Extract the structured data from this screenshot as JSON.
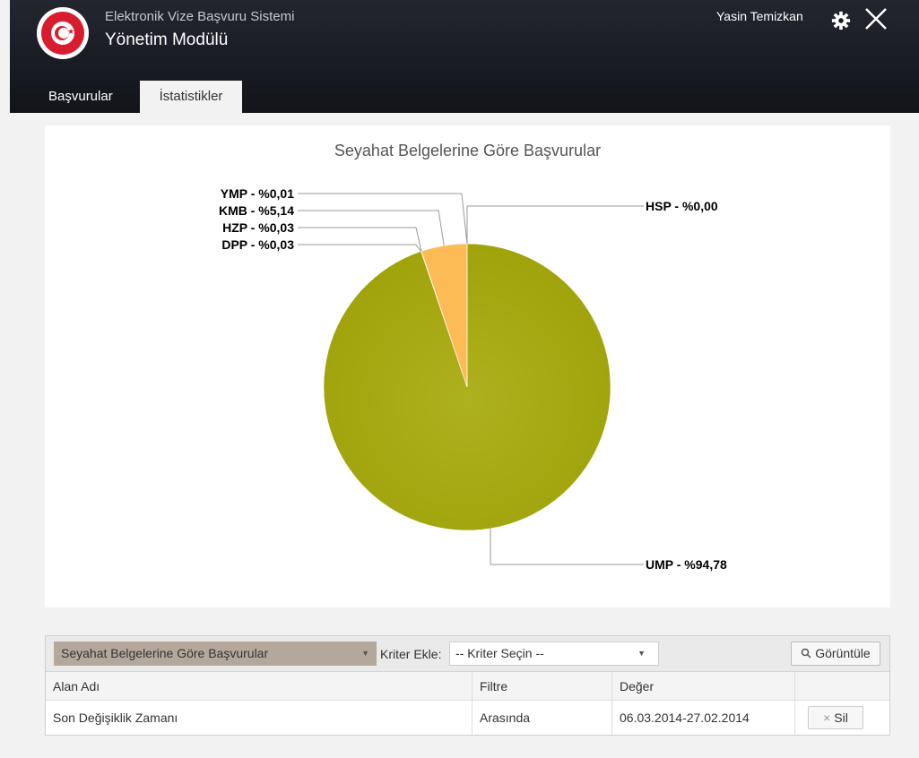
{
  "header": {
    "subtitle": "Elektronik Vize Başvuru Sistemi",
    "title": "Yönetim Modülü",
    "user": "Yasin Temizkan",
    "accent": "#d81e2e"
  },
  "tabs": [
    {
      "label": "Başvurular",
      "active": false
    },
    {
      "label": "İstatistikler",
      "active": true
    }
  ],
  "chart_data": {
    "type": "pie",
    "title": "Seyahat Belgelerine Göre Başvurular",
    "slices": [
      {
        "name": "HSP",
        "label": "HSP - %0,00",
        "value": 0.0,
        "color": "#d8dd55"
      },
      {
        "name": "UMP",
        "label": "UMP - %94,78",
        "value": 94.78,
        "color": "#a7aa12"
      },
      {
        "name": "DPP",
        "label": "DPP - %0,03",
        "value": 0.03,
        "color": "#8a8f10"
      },
      {
        "name": "HZP",
        "label": "HZP - %0,03",
        "value": 0.03,
        "color": "#c8b040"
      },
      {
        "name": "KMB",
        "label": "KMB - %5,14",
        "value": 5.14,
        "color": "#fdbb55"
      },
      {
        "name": "YMP",
        "label": "YMP - %0,01",
        "value": 0.01,
        "color": "#e0c060"
      }
    ]
  },
  "filter": {
    "report_select": "Seyahat Belgelerine Göre Başvurular",
    "criteria_label": "Kriter Ekle:",
    "criteria_select": "-- Kriter Seçin --",
    "view_button": "Görüntüle",
    "columns": [
      "Alan Adı",
      "Filtre",
      "Değer"
    ],
    "rows": [
      {
        "field": "Son Değişiklik Zamanı",
        "filter": "Arasında",
        "value": "06.03.2014-27.02.2014",
        "action": "Sil"
      }
    ]
  }
}
